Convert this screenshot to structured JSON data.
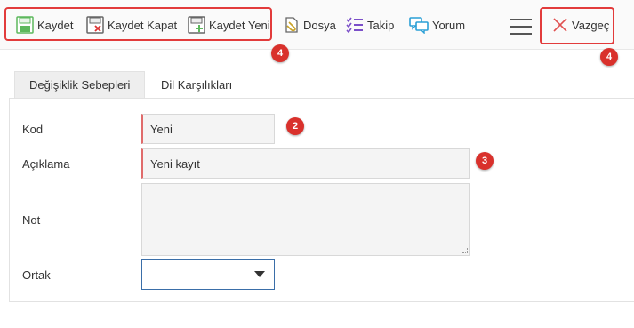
{
  "toolbar": {
    "save_label": "Kaydet",
    "save_close_label": "Kaydet Kapat",
    "save_new_label": "Kaydet Yeni",
    "file_label": "Dosya",
    "follow_label": "Takip",
    "comment_label": "Yorum",
    "cancel_label": "Vazgeç"
  },
  "annotations": {
    "badge_toolbar": "4",
    "badge_cancel": "4",
    "badge_code": "2",
    "badge_description": "3"
  },
  "tabs": [
    {
      "label": "Değişiklik Sebepleri",
      "active": true
    },
    {
      "label": "Dil Karşılıkları",
      "active": false
    }
  ],
  "form": {
    "code_label": "Kod",
    "code_value": "Yeni",
    "description_label": "Açıklama",
    "description_value": "Yeni kayıt",
    "note_label": "Not",
    "note_value": "",
    "common_label": "Ortak",
    "common_value": ""
  },
  "colors": {
    "highlight": "#e23b3b",
    "badge": "#d9312c",
    "save_icon": "#5cb85c",
    "follow_icon": "#7b4fc9",
    "comment_icon": "#2a9fd6",
    "cancel_icon": "#e05050"
  }
}
